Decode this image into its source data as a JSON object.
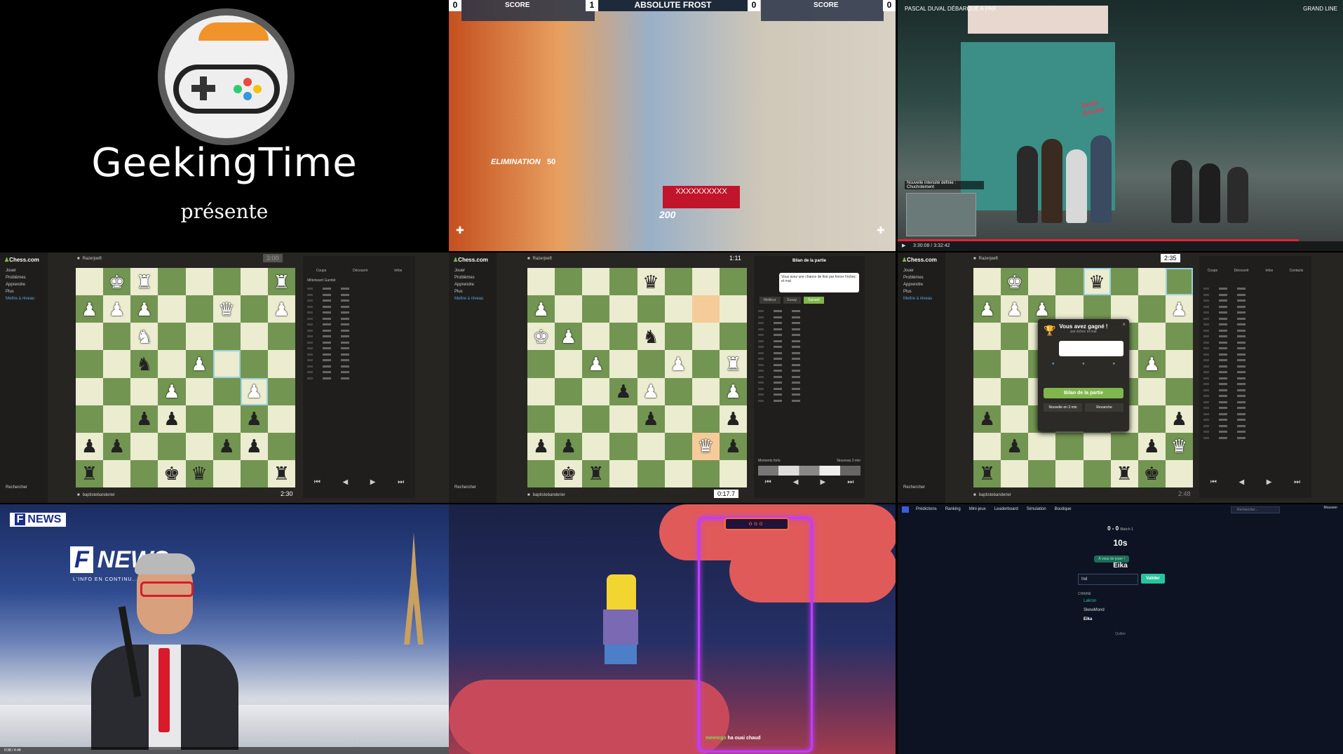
{
  "logo_tile": {
    "brand": "GeekingTime",
    "subtitle": "présente"
  },
  "overwatch_tile": {
    "title": "ABSOLUTE FROST",
    "score_label_left": "SCORE",
    "score_label_right": "SCORE",
    "score_left": "0",
    "score_mid_left": "1",
    "score_mid_right": "0",
    "score_right": "0",
    "elimination_text": "ELIMINATION",
    "elimination_count": "50",
    "damage_text": "200",
    "kill_banner": "XXXXXXXXXX"
  },
  "gta_tile": {
    "header_left": "PASCAL DUVAL DÉBARQUE A PAR",
    "header_right": "GRAND LINE",
    "store_sign": "Tasty Grusts",
    "chat_line": "Nouvelle intensité définie : Chuchotement",
    "time": "3:30:08 / 3:32:42",
    "progress": 0.9
  },
  "chess_left": {
    "site": "Chess.com",
    "nav": [
      "Jouer",
      "Problèmes",
      "Apprendre",
      "Plus",
      "Mettre à niveau"
    ],
    "search": "Rechercher",
    "top_player": "Razerjoeft",
    "bottom_player": "baptistebanderier",
    "top_clock": "3:00",
    "bottom_clock": "2:30",
    "tabs": [
      "Coups",
      "Découvrir",
      "Infos"
    ],
    "opening": "Mittetward Gambit"
  },
  "chess_middle": {
    "site": "Chess.com",
    "nav": [
      "Jouer",
      "Problèmes",
      "Apprendre",
      "Plus",
      "Mettre à niveau"
    ],
    "search": "Rechercher",
    "top_player": "Razerjoeft",
    "bottom_player": "baptistebanderier",
    "top_clock": "1:11",
    "bottom_clock": "0:17.7",
    "panel_title": "Bilan de la partie",
    "coach_text": "Vous avez une chance de finir par forcer l'échec et mat",
    "buttons": [
      "Meilleur",
      "Essay",
      "Suivant"
    ],
    "bottom_labels": [
      "Moments forts",
      "Nouveau 3 min"
    ]
  },
  "chess_right": {
    "site": "Chess.com",
    "nav": [
      "Jouer",
      "Problèmes",
      "Apprendre",
      "Plus",
      "Mettre à niveau"
    ],
    "search": "Rechercher",
    "top_player": "Razerjoeft",
    "bottom_player": "baptistebanderier",
    "top_clock": "2:35",
    "bottom_clock": "2:48",
    "modal_title": "Vous avez gagné !",
    "modal_sub": "par échec et mat",
    "modal_button": "Bilan de la partie",
    "modal_secondary": [
      "Nouvelle en 3 min",
      "Revanche"
    ],
    "tabs": [
      "Coups",
      "Découvrir",
      "Infos",
      "Contacts"
    ]
  },
  "news_tile": {
    "badge": "NEWS",
    "badge_letter": "F",
    "screen_text": "NEWS",
    "tagline": "L'INFO EN CONTINU... POUR TOUS.",
    "time": "0:38 / 4:44"
  },
  "bart_tile": {
    "neon_title": "ooo",
    "chat_user": "meenrgo",
    "chat_msg": "ha ouai chaud"
  },
  "web_tile": {
    "nav": [
      "Prédictions",
      "Ranking",
      "Mini-jeux",
      "Leaderboard",
      "Simulation",
      "Boutique"
    ],
    "search": "Rechercher...",
    "user": "Mouseer",
    "score": "0 - 0",
    "score_sub": "Match 1",
    "timer": "10s",
    "turn_pill": "À vous de jouer !",
    "player_name": "Eika",
    "input_value": "Ind",
    "submit": "Valider",
    "chain_label": "CHAINE",
    "chain": [
      "Lakron",
      "SkewMond",
      "Eika"
    ],
    "quit": "Quitter"
  },
  "colors": {
    "chess_light": "#ebecd0",
    "chess_dark": "#739552",
    "chess_green_btn": "#81b64c",
    "logo_orange": "#f0932b",
    "neon_purple": "#c13cff",
    "web_accent": "#27c4a0"
  }
}
